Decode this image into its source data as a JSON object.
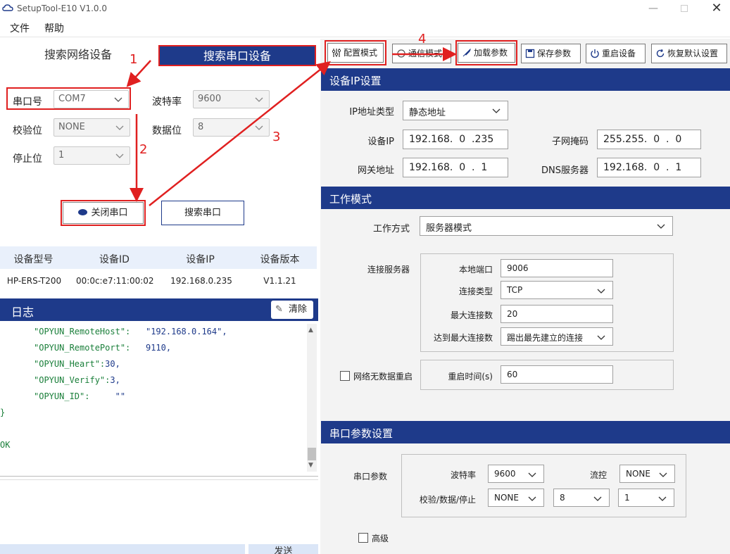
{
  "window": {
    "title": "SetupTool-E10 V1.0.0"
  },
  "menu": {
    "file": "文件",
    "help": "帮助"
  },
  "left_tabs": {
    "network": "搜索网络设备",
    "serial": "搜索串口设备"
  },
  "serial": {
    "port_label": "串口号",
    "port_value": "COM7",
    "baud_label": "波特率",
    "baud_value": "9600",
    "parity_label": "校验位",
    "parity_value": "NONE",
    "databits_label": "数据位",
    "databits_value": "8",
    "stopbits_label": "停止位",
    "stopbits_value": "1",
    "close_port": "关闭串口",
    "search_port": "搜索串口"
  },
  "device_table": {
    "headers": [
      "设备型号",
      "设备ID",
      "设备IP",
      "设备版本"
    ],
    "rows": [
      [
        "HP-ERS-T200",
        "00:0c:e7:11:00:02",
        "192.168.0.235",
        "V1.1.21"
      ]
    ]
  },
  "log": {
    "title": "日志",
    "clear": "清除",
    "lines": [
      {
        "key": "\"OPYUN_RemoteHost\":",
        "val": "\"192.168.0.164\","
      },
      {
        "key": "\"OPYUN_RemotePort\":",
        "val": "9110,"
      },
      {
        "key": "\"OPYUN_Heart\":",
        "val": "30,"
      },
      {
        "key": "\"OPYUN_Verify\":",
        "val": "3,"
      },
      {
        "key": "\"OPYUN_ID\":",
        "val": "\"\""
      }
    ],
    "brace": "}",
    "ok": "OK",
    "send": "发送"
  },
  "toolbar": {
    "config_mode": "配置模式",
    "comm_mode": "通信模式",
    "load_params": "加载参数",
    "save_params": "保存参数",
    "restart": "重启设备",
    "restore": "恢复默认设置"
  },
  "ip_section": {
    "title": "设备IP设置",
    "ip_type_label": "IP地址类型",
    "ip_type_value": "静态地址",
    "ip_label": "设备IP",
    "ip_value": "192.168.  0  .235",
    "mask_label": "子网掩码",
    "mask_value": "255.255.  0  .  0",
    "gw_label": "网关地址",
    "gw_value": "192.168.  0  .  1",
    "dns_label": "DNS服务器",
    "dns_value": "192.168.  0  .  1"
  },
  "work_section": {
    "title": "工作模式",
    "mode_label": "工作方式",
    "mode_value": "服务器模式",
    "connect_label": "连接服务器",
    "local_port_label": "本地端口",
    "local_port_value": "9006",
    "conn_type_label": "连接类型",
    "conn_type_value": "TCP",
    "max_conn_label": "最大连接数",
    "max_conn_value": "20",
    "max_reached_label": "达到最大连接数",
    "max_reached_value": "踢出最先建立的连接",
    "no_data_restart": "网络无数据重启",
    "restart_time_label": "重启时间(s)",
    "restart_time_value": "60"
  },
  "serial_section": {
    "title": "串口参数设置",
    "params_label": "串口参数",
    "baud_label": "波特率",
    "baud_value": "9600",
    "flow_label": "流控",
    "flow_value": "NONE",
    "pds_label": "校验/数据/停止",
    "parity_value": "NONE",
    "data_value": "8",
    "stop_value": "1",
    "advanced": "高级"
  },
  "annotations": {
    "a1": "1",
    "a2": "2",
    "a3": "3",
    "a4": "4"
  },
  "colors": {
    "accent": "#1e3a8a",
    "annotation": "#e02020",
    "log_text": "#1a7f3a"
  }
}
